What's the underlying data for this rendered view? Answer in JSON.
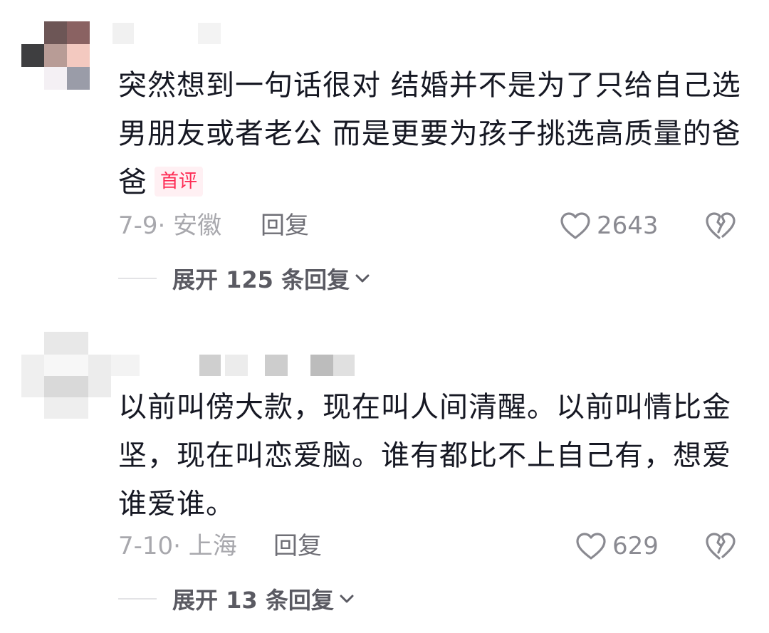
{
  "comments": [
    {
      "text": "突然想到一句话很对  结婚并不是为了只给自己选男朋友或者老公  而是更要为孩子挑选高质量的爸爸",
      "badge": "首评",
      "date": "7-9",
      "separator": "·",
      "location": "安徽",
      "reply_label": "回复",
      "likes": "2643",
      "expand_label": "展开 125 条回复"
    },
    {
      "text": "以前叫傍大款，现在叫人间清醒。以前叫情比金坚，现在叫恋爱脑。谁有都比不上自己有，想爱谁爱谁。",
      "date": "7-10",
      "separator": "·",
      "location": "上海",
      "reply_label": "回复",
      "likes": "629",
      "expand_label": "展开 13 条回复"
    }
  ],
  "icons": {
    "like": "heart-outline-icon",
    "dislike": "broken-heart-icon",
    "expand": "chevron-down-icon"
  },
  "colors": {
    "text": "#161823",
    "meta": "#a8a8ad",
    "badge_text": "#fe2c55",
    "badge_bg": "#fff0f3"
  }
}
